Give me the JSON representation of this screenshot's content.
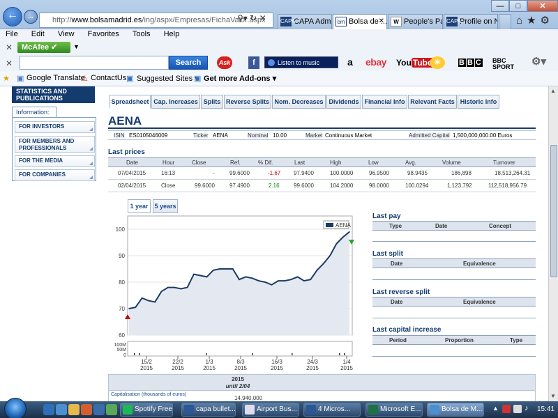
{
  "browser": {
    "address_domain": "www.bolsamadrid.es",
    "address_rest": "/ing/aspx/Empresas/FichaValor.aspx",
    "address_prefix": "http://",
    "tabs": [
      {
        "label": "CAPA Admi...",
        "fav": "capa"
      },
      {
        "label": "Bolsa de ...",
        "fav": "bm"
      },
      {
        "label": "People's Par...",
        "fav": "W"
      },
      {
        "label": "Profile on N...",
        "fav": "capa"
      }
    ],
    "menu": [
      "File",
      "Edit",
      "View",
      "Favorites",
      "Tools",
      "Help"
    ],
    "mcafee_label": "McAfee",
    "search_button": "Search",
    "music_player_label": "Listen to music",
    "toolbar_icons": {
      "amazon": "a",
      "ebay": "ebay",
      "youtube_a": "You",
      "youtube_b": "Tube",
      "bbc": [
        "B",
        "B",
        "C"
      ],
      "bbc_sport": [
        "BBC",
        "SPORT"
      ]
    },
    "favorites": {
      "google_translate": "Google Translate",
      "contactus": "ContactUs",
      "suggested_sites": "Suggested Sites ▾",
      "add_ons": "Get more Add-ons ▾"
    }
  },
  "left_nav": {
    "dark_item": "STATISTICS AND PUBLICATIONS",
    "tab_label": "Information:",
    "items": [
      "FOR INVESTORS",
      "FOR MEMBERS AND PROFESSIONALS",
      "FOR THE MEDIA",
      "FOR COMPANIES"
    ]
  },
  "page_tabs": [
    "Spreadsheet",
    "Cap. Increases",
    "Splits",
    "Reverse Splits",
    "Nom. Decreases",
    "Dividends",
    "Financial Info",
    "Relevant Facts",
    "Historic Info"
  ],
  "company": {
    "name": "AENA",
    "isin_label": "ISIN",
    "isin": "ES0105046009",
    "ticker_label": "Ticker",
    "ticker": "AENA",
    "nominal_label": "Nominal",
    "nominal": "10.00",
    "market_label": "Market",
    "market": "Continuous Market",
    "capital_label": "Admitted Capital",
    "capital": "1,500,000,000.00 Euros"
  },
  "last_prices": {
    "title": "Last prices",
    "columns": [
      "Date",
      "Hour",
      "Close",
      "Ref.",
      "% Dif.",
      "Last",
      "High",
      "Low",
      "Avg.",
      "Volume",
      "Turnover"
    ],
    "rows": [
      [
        "07/04/2015",
        "16:13",
        "-",
        "99.6000",
        "-1.67",
        "97.9400",
        "100.0000",
        "96.9500",
        "98.9435",
        "186,898",
        "18,513,264.31"
      ],
      [
        "02/04/2015",
        "Close",
        "99.6000",
        "97.4900",
        "2.16",
        "99.6000",
        "104.2000",
        "98.0000",
        "100.0294",
        "1,123,792",
        "112,518,956.79"
      ]
    ],
    "neg_color": "#cc0000",
    "pos_color": "#008800"
  },
  "range_tabs": [
    "1 year",
    "5 years"
  ],
  "chart_data": {
    "type": "line",
    "legend": "AENA",
    "ylim": [
      60,
      105
    ],
    "y_ticks": [
      "60",
      "70",
      "80",
      "90",
      "100"
    ],
    "x_ticks": [
      [
        "15/2",
        "2015"
      ],
      [
        "22/2",
        "2015"
      ],
      [
        "1/3",
        "2015"
      ],
      [
        "8/3",
        "2015"
      ],
      [
        "16/3",
        "2015"
      ],
      [
        "24/3",
        "2015"
      ],
      [
        "1/4",
        "2015"
      ]
    ],
    "series_color": "#1b3a66",
    "values": [
      70,
      70.5,
      74,
      73,
      72.5,
      76.5,
      78,
      78,
      77.5,
      78,
      83,
      82.5,
      82,
      84.5,
      85,
      85,
      85,
      81,
      82,
      81.5,
      80.5,
      80,
      79,
      80.5,
      80.5,
      81,
      82,
      80.5,
      81,
      84.5,
      87,
      90,
      94.5,
      97,
      99
    ],
    "volume_label_top": "100M",
    "volume_label_mid": "50M",
    "volume_label_zero": "0"
  },
  "right_sections": {
    "last_pay": {
      "title": "Last pay",
      "cols": [
        "Type",
        "Date",
        "Concept"
      ]
    },
    "last_split": {
      "title": "Last split",
      "cols": [
        "Date",
        "Equivalence"
      ]
    },
    "last_reverse_split": {
      "title": "Last reverse split",
      "cols": [
        "Date",
        "Equivalence"
      ]
    },
    "last_capital_increase": {
      "title": "Last capital increase",
      "cols": [
        "Period",
        "Proportion",
        "Type"
      ]
    }
  },
  "bottom_table": {
    "year": "2015",
    "until": "until 2/04",
    "row_label": "Capitalisation (thousands of euros)",
    "row_value": "14,940,000"
  },
  "taskbar": {
    "buttons": [
      "Spotify Free",
      "capa bullet...",
      "Airport Bus...",
      "4 Micros...",
      "Microsoft E...",
      "Bolsa de M..."
    ],
    "clock": "15:41"
  }
}
